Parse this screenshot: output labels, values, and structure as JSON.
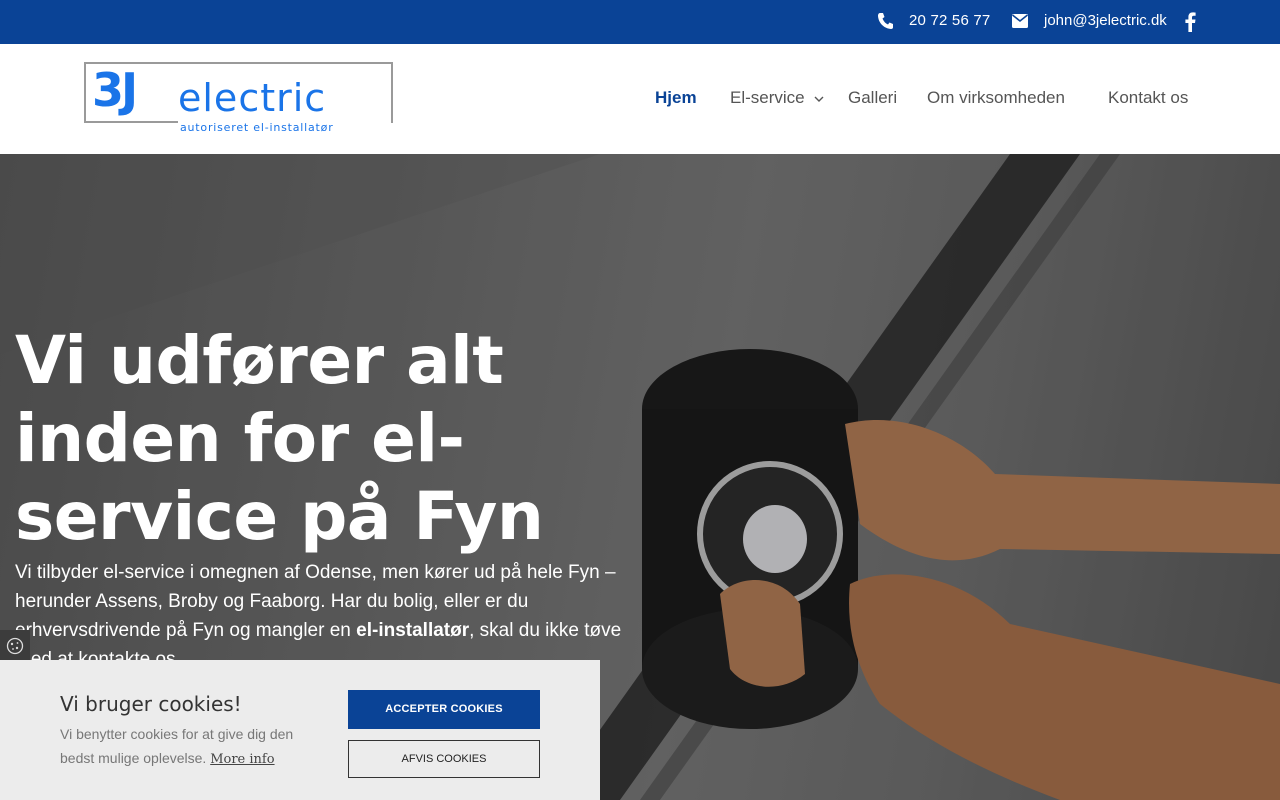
{
  "topbar": {
    "phone": "20 72 56 77",
    "email": "john@3jelectric.dk"
  },
  "logo": {
    "brand_mark": "3J",
    "brand_name": "electric",
    "tagline": "autoriseret el-installatør"
  },
  "nav": {
    "items": [
      {
        "label": "Hjem",
        "active": true
      },
      {
        "label": "El-service",
        "has_dropdown": true
      },
      {
        "label": "Galleri"
      },
      {
        "label": "Om virksomheden"
      },
      {
        "label": "Kontakt os"
      }
    ]
  },
  "hero": {
    "title": "Vi udfører alt inden for el-service på Fyn",
    "text_before": "Vi tilbyder el-service i omegnen af Odense, men kører ud på hele Fyn – herunder Assens, Broby og Faaborg. Har du bolig, eller er du erhvervsdrivende på Fyn og mangler en ",
    "text_bold": "el-installatør",
    "text_after": ", skal du ikke tøve med at kontakte os."
  },
  "cookie": {
    "title": "Vi bruger cookies!",
    "description": "Vi benytter cookies for at give dig den bedst mulige oplevelse.",
    "more_info": "More info",
    "accept_label": "ACCEPTER COOKIES",
    "decline_label": "AFVIS COOKIES"
  },
  "colors": {
    "brand_blue": "#0a4396",
    "logo_blue": "#1a74e8",
    "cookie_bg": "#ececec"
  },
  "icons": [
    "phone-icon",
    "mail-icon",
    "facebook-icon",
    "chevron-down-icon",
    "cookie-icon"
  ]
}
